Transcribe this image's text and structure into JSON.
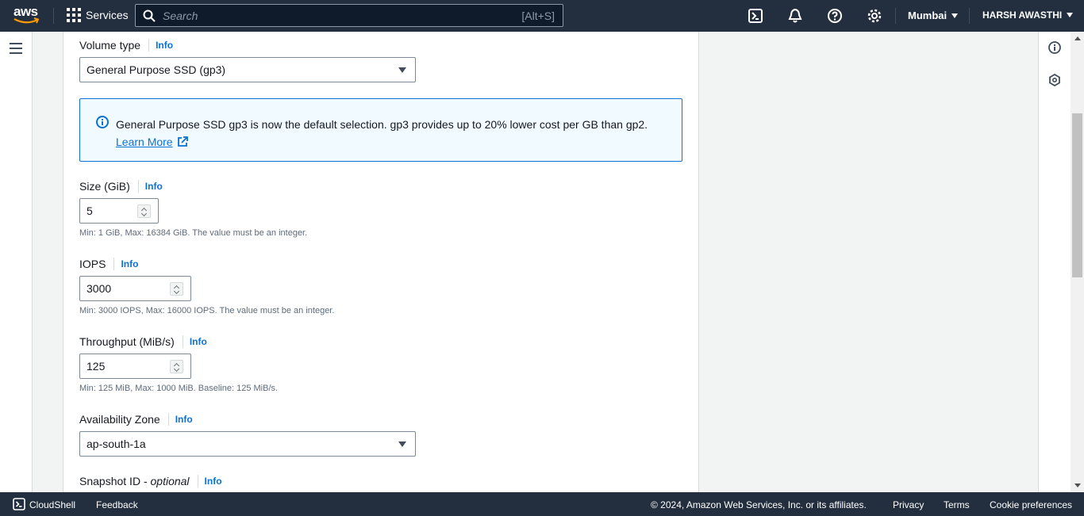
{
  "topnav": {
    "logo_text": "aws",
    "services_label": "Services",
    "search_placeholder": "Search",
    "search_shortcut": "[Alt+S]",
    "region": "Mumbai",
    "user": "HARSH AWASTHI"
  },
  "form": {
    "volume_type": {
      "label": "Volume type",
      "info": "Info",
      "value": "General Purpose SSD (gp3)"
    },
    "alert": {
      "text": "General Purpose SSD gp3 is now the default selection. gp3 provides up to 20% lower cost per GB than gp2.",
      "link": "Learn More"
    },
    "size": {
      "label": "Size (GiB)",
      "info": "Info",
      "value": "5",
      "hint": "Min: 1 GiB, Max: 16384 GiB. The value must be an integer."
    },
    "iops": {
      "label": "IOPS",
      "info": "Info",
      "value": "3000",
      "hint": "Min: 3000 IOPS, Max: 16000 IOPS. The value must be an integer."
    },
    "throughput": {
      "label": "Throughput (MiB/s)",
      "info": "Info",
      "value": "125",
      "hint": "Min: 125 MiB, Max: 1000 MiB. Baseline: 125 MiB/s."
    },
    "az": {
      "label": "Availability Zone",
      "info": "Info",
      "value": "ap-south-1a"
    },
    "snapshot": {
      "label": "Snapshot ID - ",
      "label_optional": "optional",
      "info": "Info"
    }
  },
  "footer": {
    "cloudshell": "CloudShell",
    "feedback": "Feedback",
    "copyright": "© 2024, Amazon Web Services, Inc. or its affiliates.",
    "privacy": "Privacy",
    "terms": "Terms",
    "cookies": "Cookie preferences"
  },
  "colors": {
    "nav_bg": "#232f3e",
    "link": "#0972d3",
    "alert_bg": "#f1faff",
    "aws_orange": "#ff9900"
  }
}
